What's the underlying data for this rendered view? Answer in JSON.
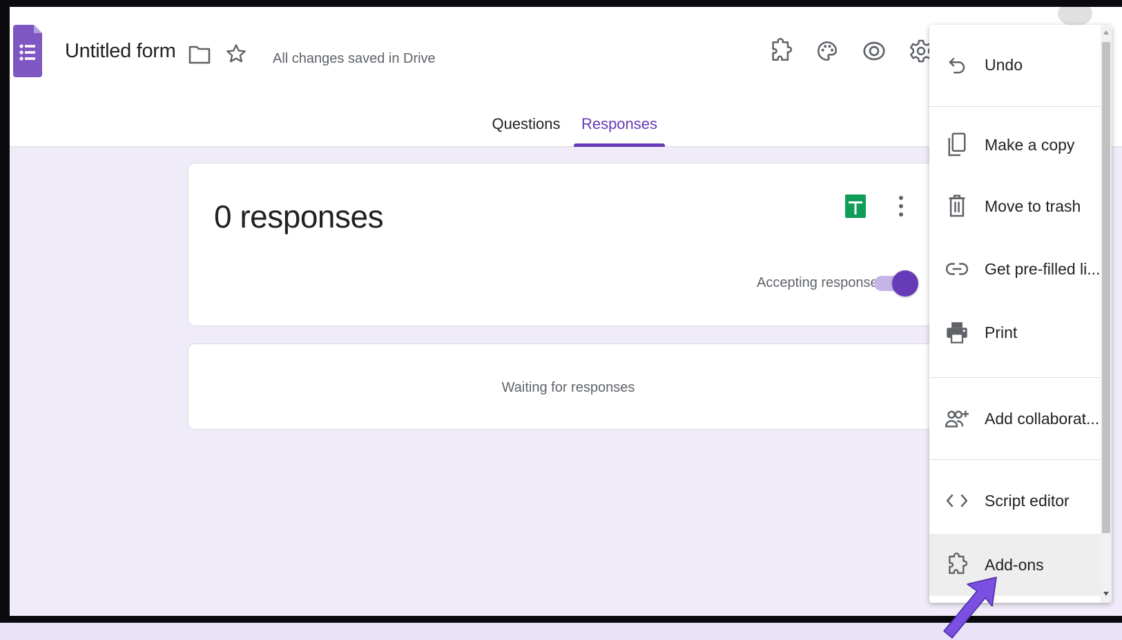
{
  "header": {
    "title": "Untitled form",
    "save_status": "All changes saved in Drive",
    "icons": [
      "forms-logo",
      "folder-icon",
      "star-icon",
      "addon-icon",
      "palette-icon",
      "eye-icon",
      "gear-icon"
    ]
  },
  "tabs": [
    {
      "label": "Questions",
      "active": false
    },
    {
      "label": "Responses",
      "active": true
    }
  ],
  "summary": {
    "count_label": "0 responses",
    "accepting_label": "Accepting responses",
    "accepting_on": true
  },
  "waiting": {
    "text": "Waiting for responses"
  },
  "menu": {
    "items": [
      {
        "label": "Undo",
        "icon": "undo-icon"
      },
      {
        "label": "Make a copy",
        "icon": "copy-icon"
      },
      {
        "label": "Move to trash",
        "icon": "trash-icon"
      },
      {
        "label": "Get pre-filled li...",
        "icon": "link-icon"
      },
      {
        "label": "Print",
        "icon": "print-icon"
      },
      {
        "label": "Add collaborat...",
        "icon": "add-collaborator-icon"
      },
      {
        "label": "Script editor",
        "icon": "code-icon"
      },
      {
        "label": "Add-ons",
        "icon": "addon-icon",
        "hovered": true
      }
    ]
  },
  "colors": {
    "accent": "#673ab7",
    "background": "#f0ebf8",
    "sheets_green": "#0f9d58",
    "annotation_arrow": "#7b4fe0"
  }
}
